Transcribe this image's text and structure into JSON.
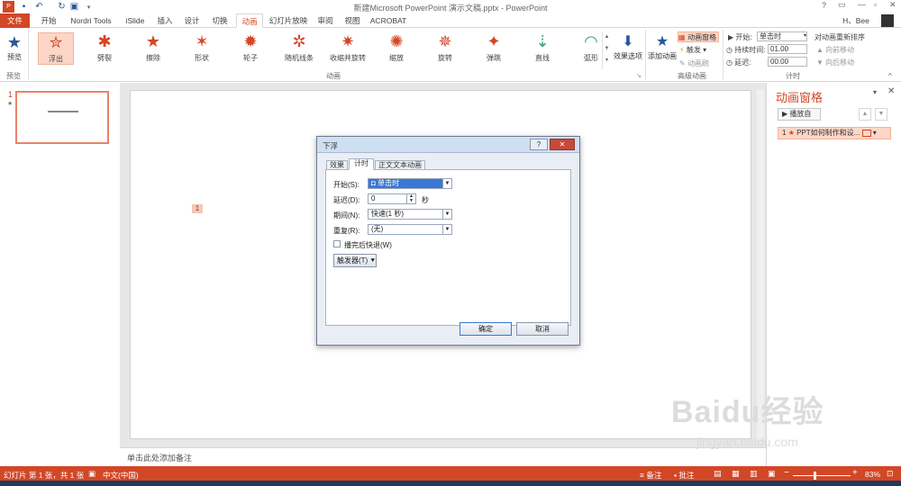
{
  "window": {
    "title": "新建Microsoft PowerPoint 演示文稿.pptx - PowerPoint",
    "help": "?",
    "user": "H、Bee"
  },
  "tabs": [
    "文件",
    "开始",
    "Nordri Tools",
    "iSlide",
    "插入",
    "设计",
    "切换",
    "动画",
    "幻灯片放映",
    "审阅",
    "视图",
    "ACROBAT"
  ],
  "ribbon": {
    "preview_label": "预览",
    "preview_group": "预览",
    "animation_group": "动画",
    "effects": [
      "浮出",
      "劈裂",
      "擦除",
      "形状",
      "轮子",
      "随机线条",
      "收缩并旋转",
      "缩放",
      "旋转",
      "弹跳",
      "直线",
      "弧形"
    ],
    "effect_options": "效果选项",
    "add_animation": "添加动画",
    "anim_pane_btn": "动画窗格",
    "trigger": "触发",
    "anim_painter": "动画刷",
    "advanced_group": "高级动画",
    "start_label": "▶ 开始:",
    "start_value": "单击时",
    "duration_label": "持续时间:",
    "duration_value": "01.00",
    "delay_label": "延迟:",
    "delay_value": "00.00",
    "reorder_label": "对动画重新排序",
    "move_earlier": "▲ 向前移动",
    "move_later": "▼ 向后移动",
    "timing_group": "计时"
  },
  "slides_pane": {
    "slide_number": "1",
    "star": "★"
  },
  "slide": {
    "anim_tag": "1"
  },
  "notes_placeholder": "单击此处添加备注",
  "anim_pane": {
    "title": "动画窗格",
    "play_from": "播放自",
    "item_index": "1",
    "item_text": "PPT如何制作和设..."
  },
  "dialog": {
    "title": "下浮",
    "tabs": [
      "效果",
      "计时",
      "正文文本动画"
    ],
    "start_label": "开始(S):",
    "start_value": "单击时",
    "delay_label": "延迟(D):",
    "delay_value": "0",
    "delay_unit": "秒",
    "period_label": "期间(N):",
    "period_value": "快速(1 秒)",
    "repeat_label": "重复(R):",
    "repeat_value": "(无)",
    "rewind_label": "播完后快退(W)",
    "rewind_checked": false,
    "trigger_btn": "触发器(T)",
    "ok": "确定",
    "cancel": "取消"
  },
  "status": {
    "slide_info": "幻灯片 第 1 张，共 1 张",
    "language": "中文(中国)",
    "notes": "备注",
    "comments": "批注",
    "zoom": "83%"
  },
  "watermark": {
    "brand": "Baidu经验",
    "url": "jingyan.baidu.com"
  },
  "colors": {
    "accent": "#d24726",
    "selected_effect": "#fcd6c7"
  }
}
